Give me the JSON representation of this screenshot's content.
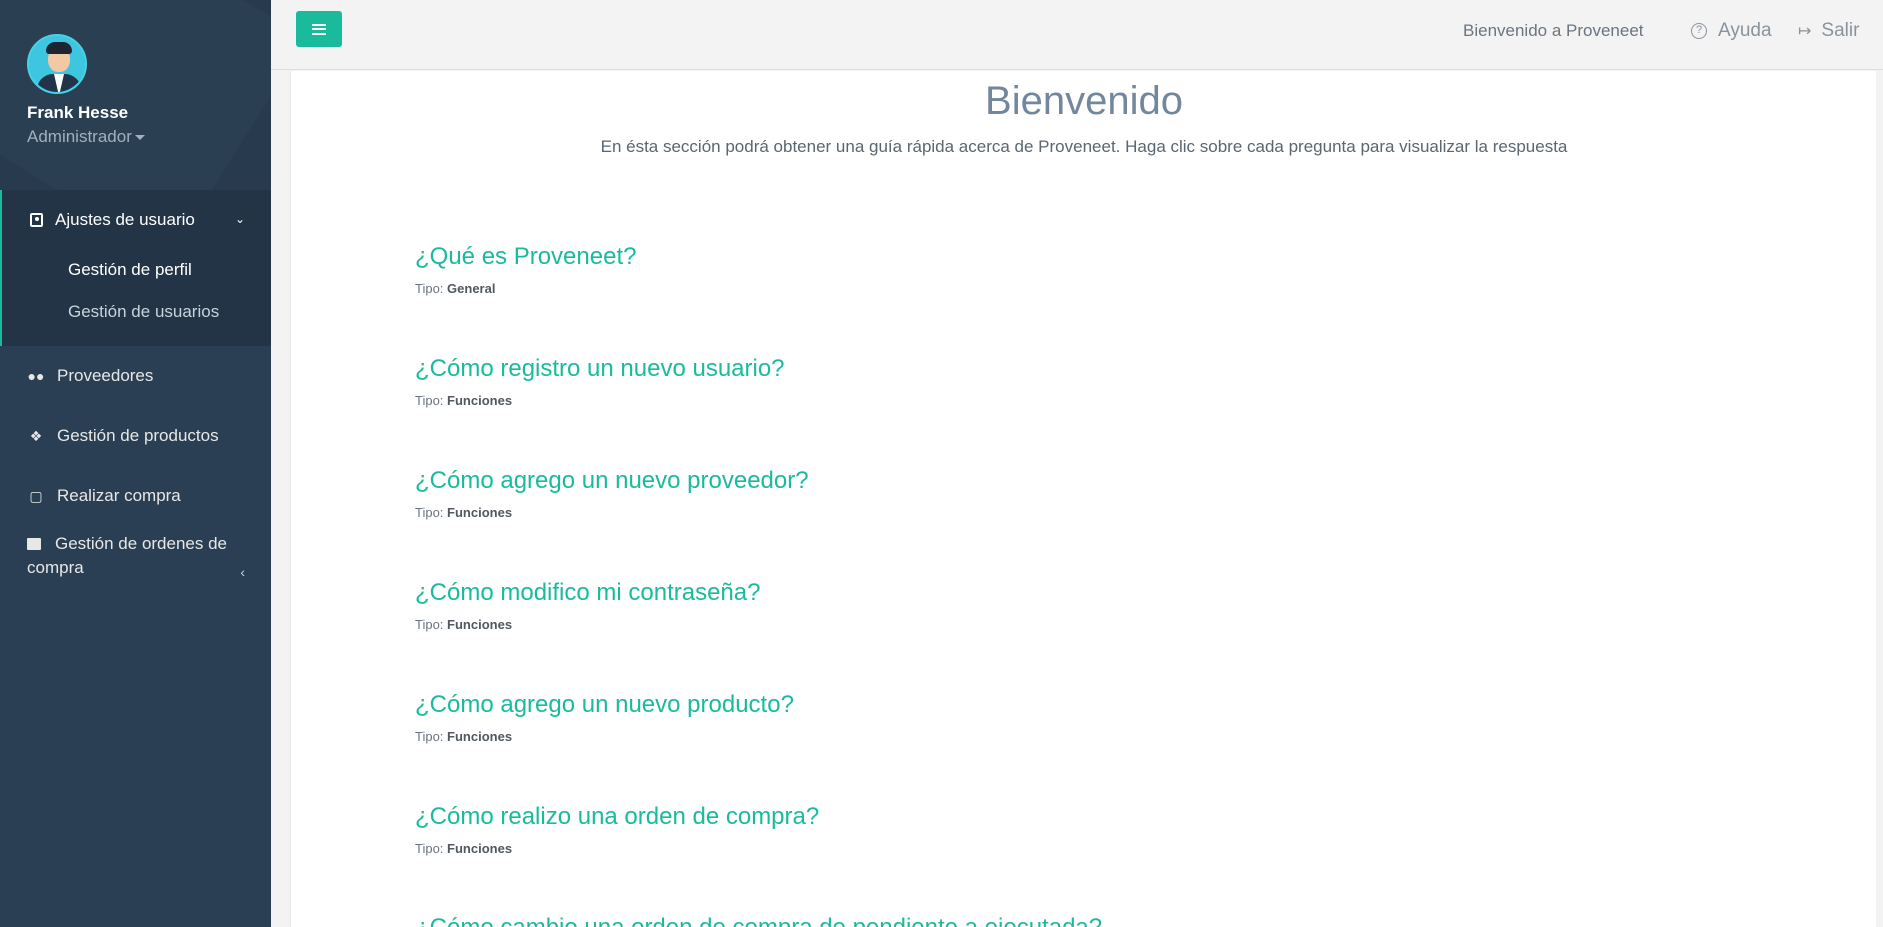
{
  "sidebar": {
    "user_name": "Frank Hesse",
    "user_role": "Administrador",
    "active_section": "Ajustes de usuario",
    "submenu": [
      "Gestión de perfil",
      "Gestión de usuarios"
    ],
    "items": [
      {
        "label": "Proveedores",
        "icon": "users-icon"
      },
      {
        "label": "Gestión de productos",
        "icon": "dropbox-icon"
      },
      {
        "label": "Realizar compra",
        "icon": "cart-icon"
      },
      {
        "label": "Gestión de ordenes de compra",
        "icon": "shopping-bag-icon"
      }
    ]
  },
  "topbar": {
    "welcome": "Bienvenido a Proveneet",
    "help_label": "Ayuda",
    "logout_label": "Salir"
  },
  "main": {
    "title": "Bienvenido",
    "subtitle": "En ésta sección podrá obtener una guía rápida acerca de Proveneet. Haga clic sobre cada pregunta para visualizar la respuesta",
    "type_label": "Tipo:",
    "faqs": [
      {
        "question": "¿Qué es Proveneet?",
        "type": "General"
      },
      {
        "question": "¿Cómo registro un nuevo usuario?",
        "type": "Funciones"
      },
      {
        "question": "¿Cómo agrego un nuevo proveedor?",
        "type": "Funciones"
      },
      {
        "question": "¿Cómo modifico mi contraseña?",
        "type": "Funciones"
      },
      {
        "question": "¿Cómo agrego un nuevo producto?",
        "type": "Funciones"
      },
      {
        "question": "¿Cómo realizo una orden de compra?",
        "type": "Funciones"
      },
      {
        "question": "¿Cómo cambio una orden de compra de pendiente a ejecutada?",
        "type": ""
      }
    ]
  },
  "colors": {
    "accent": "#1abb9c",
    "sidebar": "#2a3f54",
    "title": "#73879c"
  }
}
